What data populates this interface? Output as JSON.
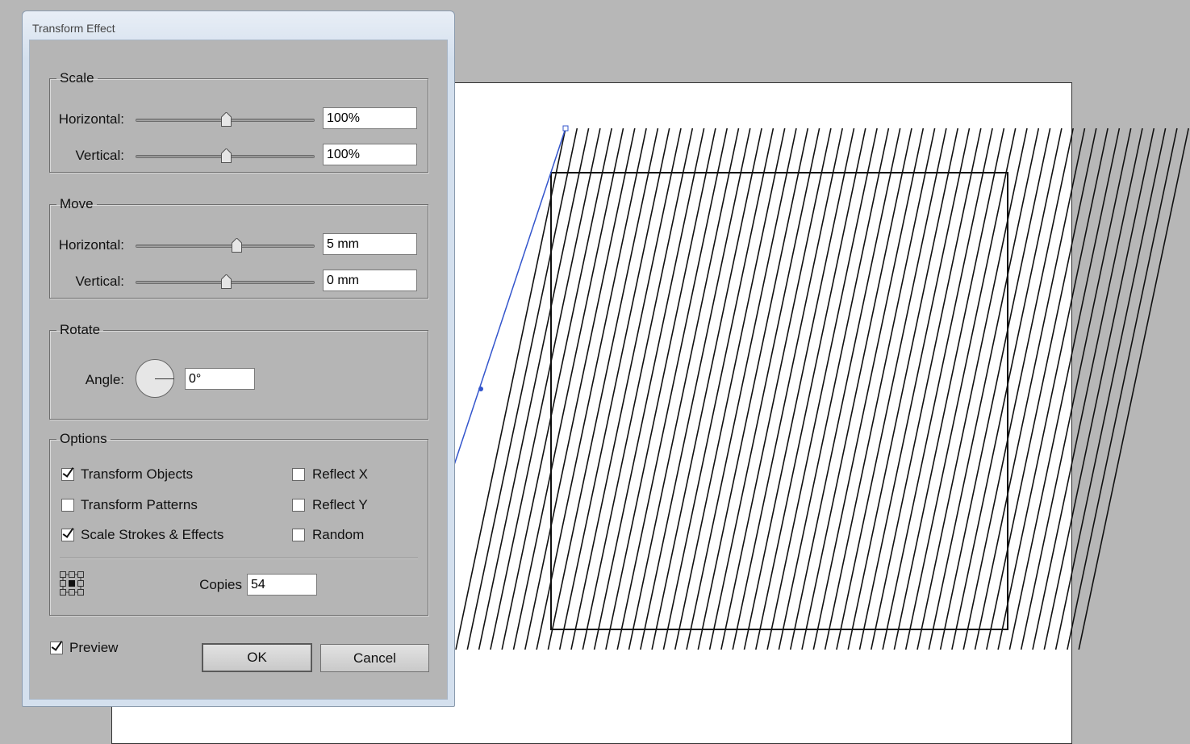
{
  "dialog": {
    "title": "Transform Effect",
    "scale": {
      "title": "Scale",
      "horizontal_label": "Horizontal:",
      "horizontal_value": "100%",
      "vertical_label": "Vertical:",
      "vertical_value": "100%"
    },
    "move": {
      "title": "Move",
      "horizontal_label": "Horizontal:",
      "horizontal_value": "5 mm",
      "vertical_label": "Vertical:",
      "vertical_value": "0 mm"
    },
    "rotate": {
      "title": "Rotate",
      "angle_label": "Angle:",
      "angle_value": "0°"
    },
    "options": {
      "title": "Options",
      "transform_objects": {
        "label": "Transform Objects",
        "checked": true
      },
      "transform_patterns": {
        "label": "Transform Patterns",
        "checked": false
      },
      "scale_strokes": {
        "label": "Scale Strokes & Effects",
        "checked": true
      },
      "reflect_x": {
        "label": "Reflect X",
        "checked": false
      },
      "reflect_y": {
        "label": "Reflect Y",
        "checked": false
      },
      "random": {
        "label": "Random",
        "checked": false
      },
      "copies_label": "Copies",
      "copies_value": "54",
      "reference_point_icon": "reference-point-grid-icon"
    },
    "preview": {
      "label": "Preview",
      "checked": true
    },
    "ok_label": "OK",
    "cancel_label": "Cancel"
  },
  "colors": {
    "canvas_background": "#b7b7b7",
    "artboard": "#ffffff",
    "selection_path": "#3355cc"
  }
}
